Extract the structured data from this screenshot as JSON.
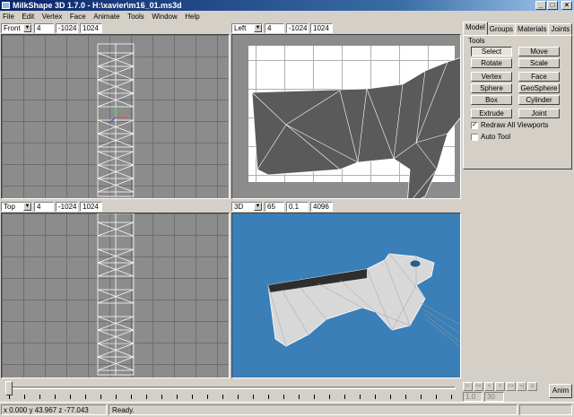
{
  "window": {
    "title": "MilkShape 3D 1.7.0 - H:\\xavier\\m16_01.ms3d",
    "minimize": "_",
    "maximize": "□",
    "close": "×"
  },
  "menu": [
    "File",
    "Edit",
    "Vertex",
    "Face",
    "Animate",
    "Tools",
    "Window",
    "Help"
  ],
  "viewports": {
    "front": {
      "view": "Front",
      "v1": "4",
      "v2": "-1024",
      "v3": "1024"
    },
    "left": {
      "view": "Left",
      "v1": "4",
      "v2": "-1024",
      "v3": "1024"
    },
    "top": {
      "view": "Top",
      "v1": "4",
      "v2": "-1024",
      "v3": "1024"
    },
    "3d": {
      "view": "3D",
      "v1": "65",
      "v2": "0.1",
      "v3": "4096"
    }
  },
  "panel": {
    "tabs": [
      "Model",
      "Groups",
      "Materials",
      "Joints"
    ],
    "tools_label": "Tools",
    "buttons": [
      "Select",
      "Move",
      "Rotate",
      "Scale",
      "Vertex",
      "Face",
      "Sphere",
      "GeoSphere",
      "Box",
      "Cylinder",
      "Extrude",
      "Joint"
    ],
    "redraw_label": "Redraw All Viewports",
    "redraw_checked": "✓",
    "auto_tool_label": "Auto Tool"
  },
  "anim": {
    "frame_start": "1.0",
    "frame_end": "30",
    "anim_button": "Anim",
    "nav": [
      "|<",
      "<<",
      "<",
      ">",
      ">>",
      ">|",
      "o"
    ]
  },
  "status": {
    "coords": "x 0.000 y 43.967 z -77.043",
    "message": "Ready."
  },
  "colors": {
    "viewport_3d_bg": "#3a7fb7",
    "title_start": "#0a246a"
  }
}
